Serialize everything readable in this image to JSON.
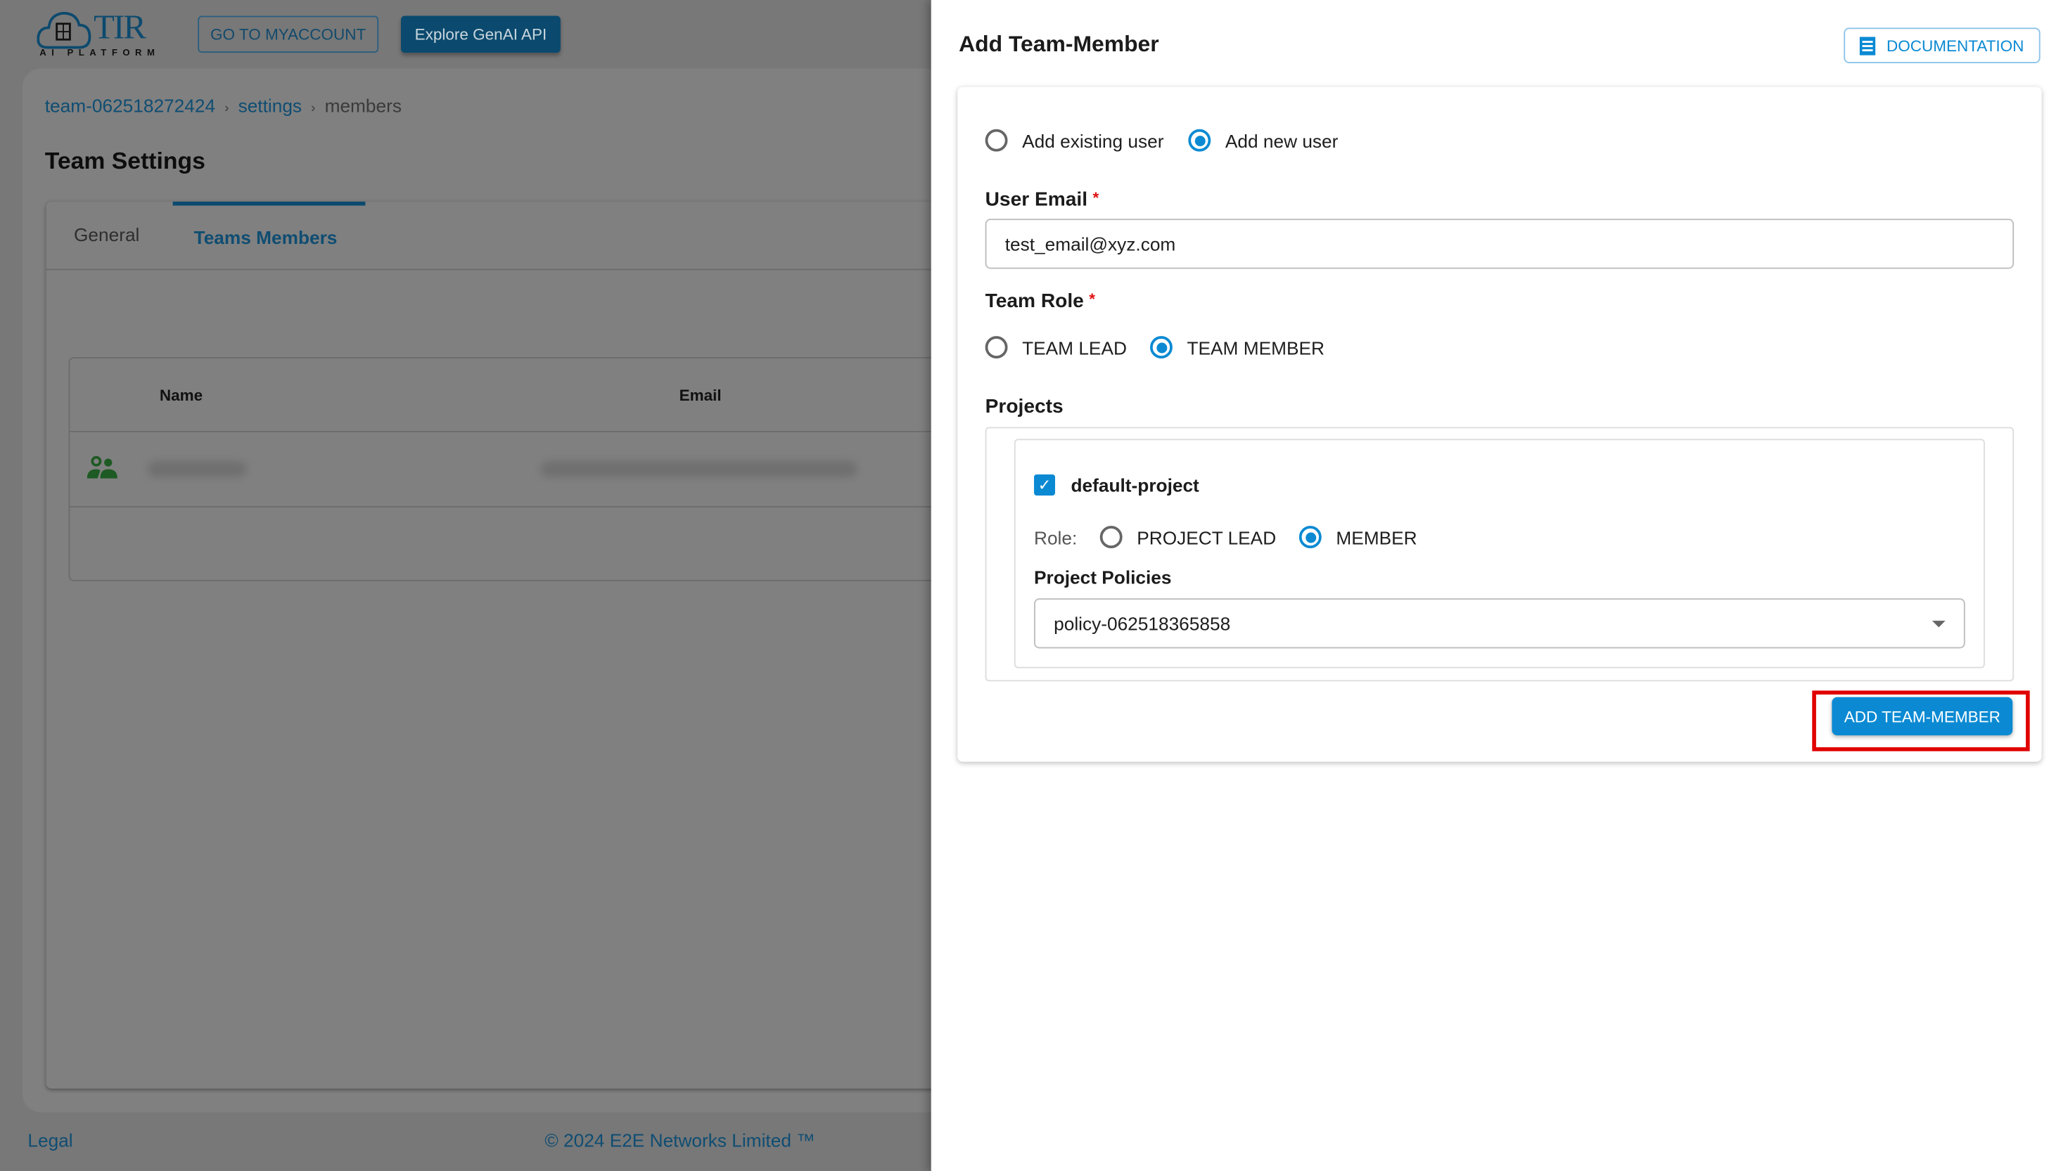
{
  "header": {
    "logo_text": "TIR",
    "logo_subtext": "AI PLATFORM",
    "myaccount_label": "GO TO MYACCOUNT",
    "genai_label": "Explore GenAI API"
  },
  "breadcrumb": [
    "team-062518272424",
    "settings",
    "members"
  ],
  "page_title": "Team Settings",
  "tabs": [
    {
      "label": "General",
      "active": false
    },
    {
      "label": "Teams Members",
      "active": true
    }
  ],
  "table": {
    "columns": [
      "Name",
      "Email"
    ],
    "rows": [
      {
        "icon": "group-icon",
        "name": "(blurred)",
        "email": "(blurred)"
      }
    ]
  },
  "footer": {
    "legal": "Legal",
    "copyright": "© 2024 E2E Networks Limited ™"
  },
  "drawer": {
    "title": "Add Team-Member",
    "documentation_label": "DOCUMENTATION",
    "user_mode": {
      "options": [
        "Add existing user",
        "Add new user"
      ],
      "selected": "Add new user"
    },
    "email": {
      "label": "User Email",
      "required_mark": "*",
      "value": "test_email@xyz.com"
    },
    "team_role": {
      "label": "Team Role",
      "required_mark": "*",
      "options": [
        "TEAM LEAD",
        "TEAM MEMBER"
      ],
      "selected": "TEAM MEMBER"
    },
    "projects": {
      "label": "Projects",
      "items": [
        {
          "name": "default-project",
          "checked": true,
          "role_label": "Role:",
          "role_options": [
            "PROJECT LEAD",
            "MEMBER"
          ],
          "role_selected": "MEMBER",
          "policies_label": "Project Policies",
          "policy_value": "policy-062518365858"
        }
      ]
    },
    "submit_label": "ADD TEAM-MEMBER"
  },
  "colors": {
    "accent": "#0b8ad3",
    "brand": "#0b4a6e",
    "required": "#e01010",
    "highlight": "#e00000"
  }
}
